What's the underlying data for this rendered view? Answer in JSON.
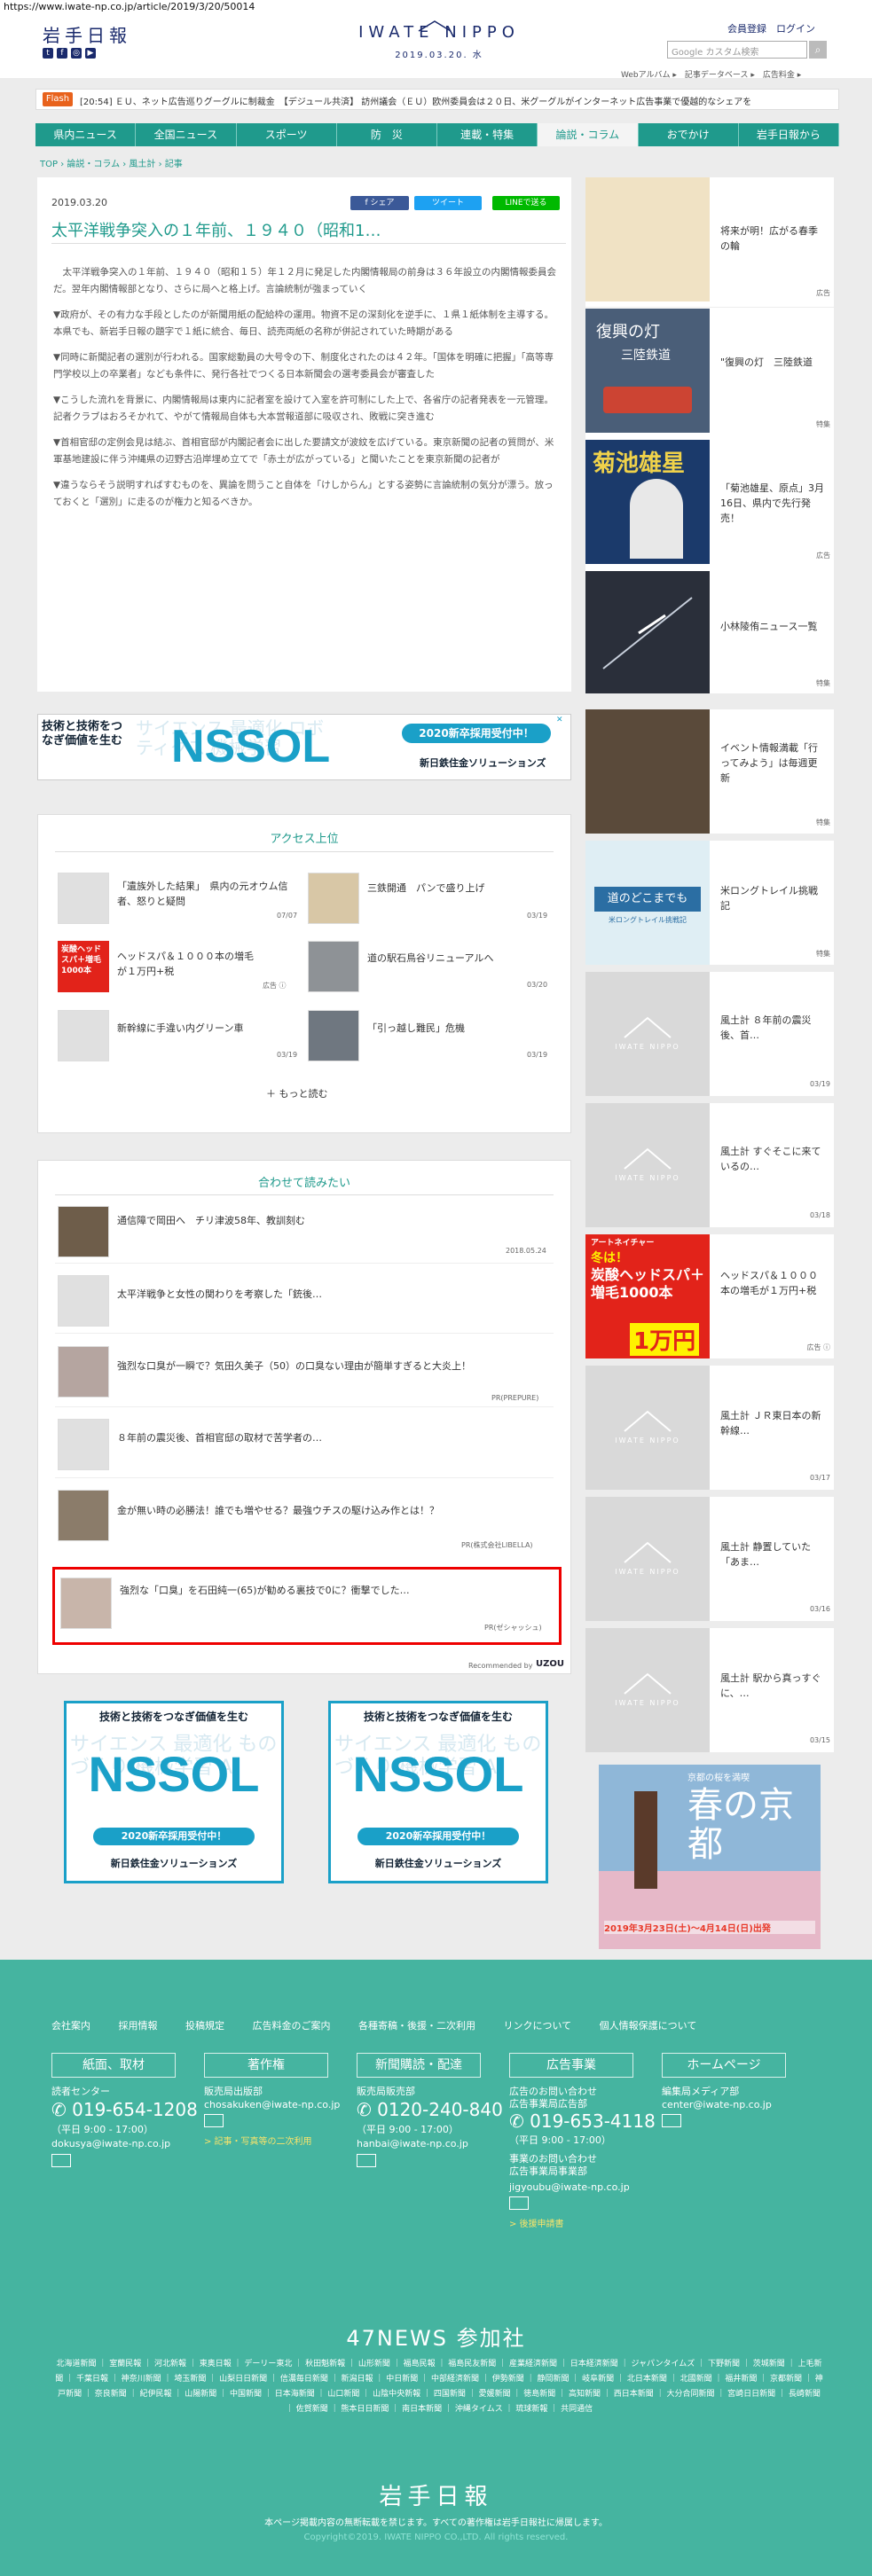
{
  "url": "https://www.iwate-np.co.jp/article/2019/3/20/50014",
  "header": {
    "logo_jp": "岩手日報",
    "brand": "IWATE NIPPO",
    "date": "2019.03.20. 水",
    "links": "会員登録　ログイン",
    "search_placeholder": "Google カスタム検索",
    "sublinks": "Webアルバム ▸　記事データベース ▸　広告料金 ▸"
  },
  "flash": {
    "badge": "Flash",
    "text": "[20:54] ＥＵ、ネット広告巡りグーグルに制裁金　【デジュール共済】 訪州議会（ＥＵ）欧州委員会は２０日、米グーグルがインターネット広告事業で優越的なシェアを"
  },
  "nav": [
    "県内ニュース",
    "全国ニュース",
    "スポーツ",
    "防　災",
    "連載・特集",
    "論説・コラム",
    "おでかけ",
    "岩手日報から"
  ],
  "breadcrumb": "TOP ›  論説・コラム ›  風土計 ›  記事",
  "article": {
    "date": "2019.03.20",
    "share": [
      "f シェア",
      "ツイート",
      "LINEで送る"
    ],
    "title": "太平洋戦争突入の１年前、１９４０（昭和1…",
    "paragraphs": [
      "　太平洋戦争突入の１年前、１９４０（昭和１５）年１２月に発足した内閣情報局の前身は３６年設立の内閣情報委員会だ。翌年内閣情報部となり、さらに局へと格上げ。言論統制が強まっていく",
      "▼政府が、その有力な手段としたのが新聞用紙の配給枠の運用。物資不足の深刻化を逆手に、１県１紙体制を主導する。本県でも、新岩手日報の題字で１紙に統合、毎日、読売両紙の名称が併記されていた時期がある",
      "▼同時に新聞記者の選別が行われる。国家総動員の大号令の下、制度化されたのは４２年。「国体を明確に把握」「高等専門学校以上の卒業者」なども条件に、発行各社でつくる日本新聞会の選考委員会が審査した",
      "▼こうした流れを背景に、内閣情報局は東内に記者室を設けて入室を許可制にした上で、各省庁の記者発表を一元管理。記者クラブはおろそかれて、やがて情報局自体も大本営報道部に吸収され、敗戦に突き進む",
      "▼首相官邸の定例会見は結ぶ、首相官邸が内閣記者会に出した要請文が波紋を広げている。東京新聞の記者の質問が、米軍基地建設に伴う沖縄県の辺野古沿岸埋め立てで「赤土が広がっている」と聞いたことを東京新聞の記者が",
      "▼違うならそう説明すればすむものを、異論を問うこと自体を「けしからん」とする姿勢に言論統制の気分が漂う。放っておくと「選別」に走るのが権力と知るべきか。"
    ]
  },
  "ads": {
    "nssol_left": "技術と技術をつなぎ価値を生む",
    "nssol_word": "NSSOL",
    "nssol_bg": "サイエンス 最適化 ロボティクス 機械学習",
    "nssol_recruit": "2020新卒採用受付中！",
    "nssol_company": "新日鉄住金ソリューションズ",
    "nssol_sq_top": "技術と技術をつなぎ価値を生む",
    "nssol_sq_bg": "サイエンス 最適化 ものづくり 機械学習 AI",
    "kyoto_title": "春の京都",
    "kyoto_sub": "京都の桜を満喫",
    "kyoto_dates": "2019年3月23日(土)～4月14日(日)出発",
    "spa_top": "冬は！",
    "spa_main": "炭酸ヘッドスパ＋増毛1000本",
    "spa_price": "1万円",
    "spa_tag": "アートネイチャー"
  },
  "access": {
    "title": "アクセス上位",
    "items": [
      {
        "t": "「遺族外した結果」　県内の元オウム信者、怒りと疑問",
        "m": "07/07"
      },
      {
        "t": "三鉄開通　パンで盛り上げ",
        "m": "03/19"
      },
      {
        "t": "ヘッドスパ＆１０００本の増毛が１万円+税",
        "m": "広告 ⓘ"
      },
      {
        "t": "道の駅石鳥谷リニューアルへ",
        "m": "03/20"
      },
      {
        "t": "新幹線に手違い内グリーン車",
        "m": "03/19"
      },
      {
        "t": "「引っ越し難民」危機",
        "m": "03/19"
      }
    ],
    "more": "もっと読む"
  },
  "related": {
    "title": "合わせて読みたい",
    "items": [
      {
        "t": "通信障で岡田へ　チリ津波58年、教訓刻む",
        "m": "2018.05.24"
      },
      {
        "t": "太平洋戦争と女性の関わりを考察した「銃後…",
        "m": ""
      },
      {
        "t": "強烈な口臭が一瞬で？気田久美子（50）の口臭ない理由が簡単すぎると大炎上！",
        "m": "PR(PREPURE)"
      },
      {
        "t": "８年前の震災後、首相官邸の取材で苦学者の…",
        "m": ""
      },
      {
        "t": "金が無い時の必勝法！誰でも増やせる？最強ウチスの駆け込み作とは！？",
        "m": "PR(株式会社LIBELLA)"
      },
      {
        "t": "強烈な「口臭」を石田純一(65)が勧める裏技で0に？衝撃でした…",
        "m": "PR(ゼシャッシュ)"
      }
    ],
    "recommended": "Recommended by",
    "uzou": "UZOU"
  },
  "sidebar": [
    {
      "t": "将来が明！広がる春季の輪",
      "m": "広告"
    },
    {
      "t": "\"復興の灯　三陸鉄道",
      "m": "特集"
    },
    {
      "t": "「菊池雄星、原点」3月16日、県内で先行発売！",
      "m": "広告"
    },
    {
      "t": "小林陵侑ニュース一覧",
      "m": "特集"
    },
    {
      "t": "イベント情報満載「行ってみよう」は毎週更新",
      "m": "特集"
    },
    {
      "t": "米ロングトレイル挑戦記",
      "m": "特集"
    },
    {
      "t": "風土計 ８年前の震災後、首…",
      "m": "03/19"
    },
    {
      "t": "風土計 すぐそこに来ているの…",
      "m": "03/18"
    },
    {
      "t": "ヘッドスパ＆１０００本の増毛が１万円+税",
      "m": "広告 ⓘ"
    },
    {
      "t": "風土計 ＪＲ東日本の新幹線…",
      "m": "03/17"
    },
    {
      "t": "風土計 静置していた「あま…",
      "m": "03/16"
    },
    {
      "t": "風土計 駅から真っすぐに、…",
      "m": "03/15"
    }
  ],
  "side_text": {
    "fukko_title": "復興の灯",
    "fukko_sub": "三陸鉄道",
    "kikuchi": "菊池雄星",
    "long_trail": "道のどこまでも",
    "long_trail_sub": "米ロングトレイル挑戦記"
  },
  "iwate_tile": "IWATE NIPPO",
  "footer": {
    "nav": [
      "会社案内",
      "採用情報",
      "投稿規定",
      "広告料金のご案内",
      "各種寄稿・後援・二次利用",
      "リンクについて",
      "個人情報保護について"
    ],
    "buttons": [
      "紙面、取材",
      "著作権",
      "新聞購読・配達",
      "広告事業",
      "ホームページ"
    ],
    "col1": {
      "label": "読者センター",
      "tel": "019-654-1208",
      "hours": "（平日 9:00 - 17:00）",
      "mail": "dokusya@iwate-np.co.jp"
    },
    "col2": {
      "label": "販売局出版部",
      "mail": "chosakuken@iwate-np.co.jp",
      "link": "> 記事・写真等の二次利用"
    },
    "col3": {
      "label": "販売局販売部",
      "tel": "0120-240-840",
      "hours": "（平日 9:00 - 17:00）",
      "mail": "hanbai@iwate-np.co.jp"
    },
    "col4": {
      "label1": "広告のお問い合わせ",
      "label2": "広告事業局広告部",
      "tel": "019-653-4118",
      "hours": "（平日 9:00 - 17:00）",
      "label3": "事業のお問い合わせ",
      "label4": "広告事業局事業部",
      "mail": "jigyoubu@iwate-np.co.jp",
      "link": "> 後援申請書"
    },
    "col5": {
      "label": "編集局メディア部",
      "mail": "center@iwate-np.co.jp"
    },
    "news47": "47NEWS 参加社",
    "papers": "北海道新聞 ｜ 室蘭民報 ｜ 河北新報 ｜ 東奥日報 ｜ デーリー東北 ｜ 秋田魁新報 ｜ 山形新聞 ｜ 福島民報 ｜ 福島民友新聞 ｜ 産業経済新聞 ｜ 日本経済新聞 ｜ ジャパンタイムズ ｜ 下野新聞 ｜ 茨城新聞 ｜ 上毛新聞 ｜ 千葉日報 ｜ 神奈川新聞 ｜ 埼玉新聞 ｜ 山梨日日新聞 ｜ 信濃毎日新聞 ｜ 新潟日報 ｜ 中日新聞 ｜ 中部経済新聞 ｜ 伊勢新聞 ｜ 静岡新聞 ｜ 岐阜新聞 ｜ 北日本新聞 ｜ 北國新聞 ｜ 福井新聞 ｜ 京都新聞 ｜ 神戸新聞 ｜ 奈良新聞 ｜ 紀伊民報 ｜ 山陽新聞 ｜ 中国新聞 ｜ 日本海新聞 ｜ 山口新聞 ｜ 山陰中央新報 ｜ 四国新聞 ｜ 愛媛新聞 ｜ 徳島新聞 ｜ 高知新聞 ｜ 西日本新聞 ｜ 大分合同新聞 ｜ 宮崎日日新聞 ｜ 長崎新聞 ｜ 佐賀新聞 ｜ 熊本日日新聞 ｜ 南日本新聞 ｜ 沖縄タイムス ｜ 琉球新報 ｜ 共同通信",
    "logo": "岩手日報",
    "notice": "本ページ掲載内容の無断転載を禁じます。すべての著作権は岩手日報社に帰属します。",
    "copyright": "Copyright©2019. IWATE NIPPO CO.,LTD. All rights reserved."
  }
}
